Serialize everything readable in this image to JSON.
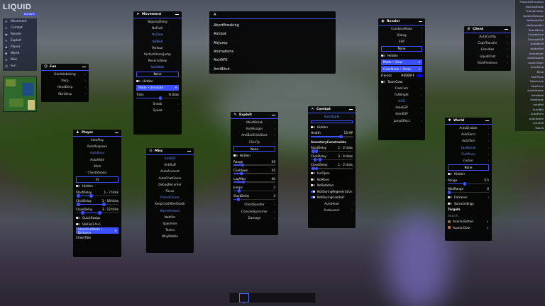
{
  "logo": {
    "title": "LIQUID",
    "subtitle": "BOUNCE"
  },
  "categories": [
    "Movement",
    "Combat",
    "Render",
    "Exploit",
    "Player",
    "World",
    "Misc",
    "Fun"
  ],
  "modlist": [
    "ProjectileFunction",
    "NoSlowBreak",
    "FriendClicker",
    "NoItemRelease",
    "NoRotateSet",
    "NoRotateSet",
    "DoorsBlock",
    "CrystalAura",
    "StrongeESP",
    "AutoBuild",
    "NoAxeFall",
    "AutoArmor",
    "AutoDisable",
    "AutoClicker",
    "AutoSoup",
    "Blink",
    "FastPlace",
    "Backtrack",
    "FastPlace",
    "AutoDisable",
    "SafeWalk",
    "FastBreak",
    "AutoPot",
    "AutoBot",
    "AutoFarm",
    "AutoTotem",
    "AntiAFK",
    "Reach"
  ],
  "search": {
    "query": "A",
    "results": [
      "AbortBreaking",
      "Aimbot",
      "AirJump",
      "Animations",
      "AntiAFK",
      "AntiBlind"
    ]
  },
  "fun": {
    "title": "Fun",
    "items": [
      "Gamblebaking",
      "Derp",
      "HandDerp",
      "SkinDerp"
    ]
  },
  "movement": {
    "title": "Movement",
    "items": [
      "NoJumpDelay",
      "NoPush",
      "NoSlow",
      "NoWeb",
      "Parkour",
      "PerfectHorseJump",
      "ReverseStep",
      "SafeWalk"
    ],
    "on": [
      false,
      false,
      true,
      true,
      false,
      false,
      false,
      true
    ],
    "none": "None",
    "hidden": "Hidden",
    "mode": "Mode • Simulate",
    "ticks_label": "Ticks",
    "ticks": "6 ticks",
    "bottom": [
      "Sneak",
      "Speed"
    ]
  },
  "player": {
    "title": "Player",
    "items": [
      "AutoPlay",
      "AutoRespawn",
      "AutoSoup",
      "AutoWalk",
      "Blink",
      "ChestStealer"
    ],
    "on": [
      false,
      false,
      true,
      false,
      false,
      false
    ],
    "box": "III",
    "hidden": "Hidden",
    "start_label": "StartDelay",
    "start": "1 - 7 ticks",
    "click_label": "ClickDelay",
    "click": "1 - 18 ticks",
    "close_label": "CloseDelay",
    "close": "3 - 12 ticks",
    "quick": "QuickSwaps",
    "via": "ViaFix(1.9+)",
    "sel": "SelectionMode • Distance",
    "last": "ChestTitle"
  },
  "misc": {
    "title": "Misc",
    "items": [
      "AntiBot",
      "AntiSuff",
      "AutoAccount",
      "AutoChatGame",
      "DebugRecorder",
      "Focus",
      "FriendClicker",
      "KeepChatAfterDeath",
      "NameProtect",
      "Notifier",
      "Spammer",
      "Teams",
      "WhyMobile"
    ],
    "on": [
      true,
      false,
      false,
      false,
      false,
      false,
      true,
      false,
      true,
      false,
      false,
      false,
      false
    ]
  },
  "exploit": {
    "title": "Exploit",
    "items": [
      "AbortBreak",
      "AntiHunger",
      "AntiBadClickSlots",
      "ClickTp"
    ],
    "on": [
      false,
      false,
      false,
      false
    ],
    "none": "None",
    "hidden": "Hidden",
    "range_label": "Range",
    "range": "39",
    "cooldown_label": "Cooldown",
    "cooldown": "35",
    "lag_label": "LagAfter",
    "lag": "40",
    "jumps_label": "Jumps",
    "jumps": "3",
    "sd_label": "StartDelay",
    "sd": "3",
    "bottom": [
      "ClientSpoofer",
      "ConsoleSpammer",
      "Damage"
    ]
  },
  "combat": {
    "title": "Combat",
    "items": [
      "AutoApple"
    ],
    "on": [
      true
    ],
    "hidden": "Hidden",
    "health_label": "Health",
    "health": "15 HP",
    "inv": "InventoryConstraints",
    "sd_label": "StartDelay",
    "sd": "1 - 2 ticks",
    "cd_label": "ClickDelay",
    "cd": "2 - 4 ticks",
    "close_label": "CloseDelay",
    "close": "1 - 2 ticks",
    "t1": "InvOpen",
    "t2": "NoMove",
    "t3": "NoRotation",
    "t4": "NotDuringRegeneration",
    "t5": "NotDuringCombat",
    "bottom": [
      "AutoHead",
      "AutoLeave"
    ]
  },
  "render": {
    "title": "Render",
    "items": [
      "CombineMobs",
      "Dialog",
      "ESP"
    ],
    "on": [
      false,
      false,
      false
    ],
    "none": "None",
    "hidden": "Hidden",
    "mode": "Mode • Glow",
    "color": "ColorMode • Static",
    "friends": "Friends",
    "hex": "#0000FF",
    "team": "TeamColor",
    "bottom": [
      "FreeCam",
      "FullBright",
      "HUD",
      "HoleESP",
      "ItemESP",
      "JumpEffect"
    ],
    "bon": [
      false,
      false,
      true,
      false,
      false,
      false
    ]
  },
  "client": {
    "title": "Client",
    "items": [
      "AutoConfig",
      "CapeTransfer",
      "Gravities",
      "LiquidChat",
      "RichPresence"
    ]
  },
  "world": {
    "title": "World",
    "items": [
      "AutoDisable",
      "AutoFarm",
      "AutoTool",
      "FastBreak",
      "FastPlace",
      "Fucker"
    ],
    "on": [
      false,
      false,
      false,
      true,
      true,
      false
    ],
    "none": "None",
    "hidden": "Hidden",
    "range_label": "Range",
    "range": "5.5",
    "wall_label": "WallRange",
    "wall": "0",
    "ent": "Entrance",
    "sur": "Surroundings",
    "targets": "Targets",
    "search": "Search",
    "acacia_button": "Acacia Button",
    "acacia_door": "Acacia Door"
  },
  "colors": {
    "accent": "#3b50ff",
    "panel": "#000000"
  }
}
